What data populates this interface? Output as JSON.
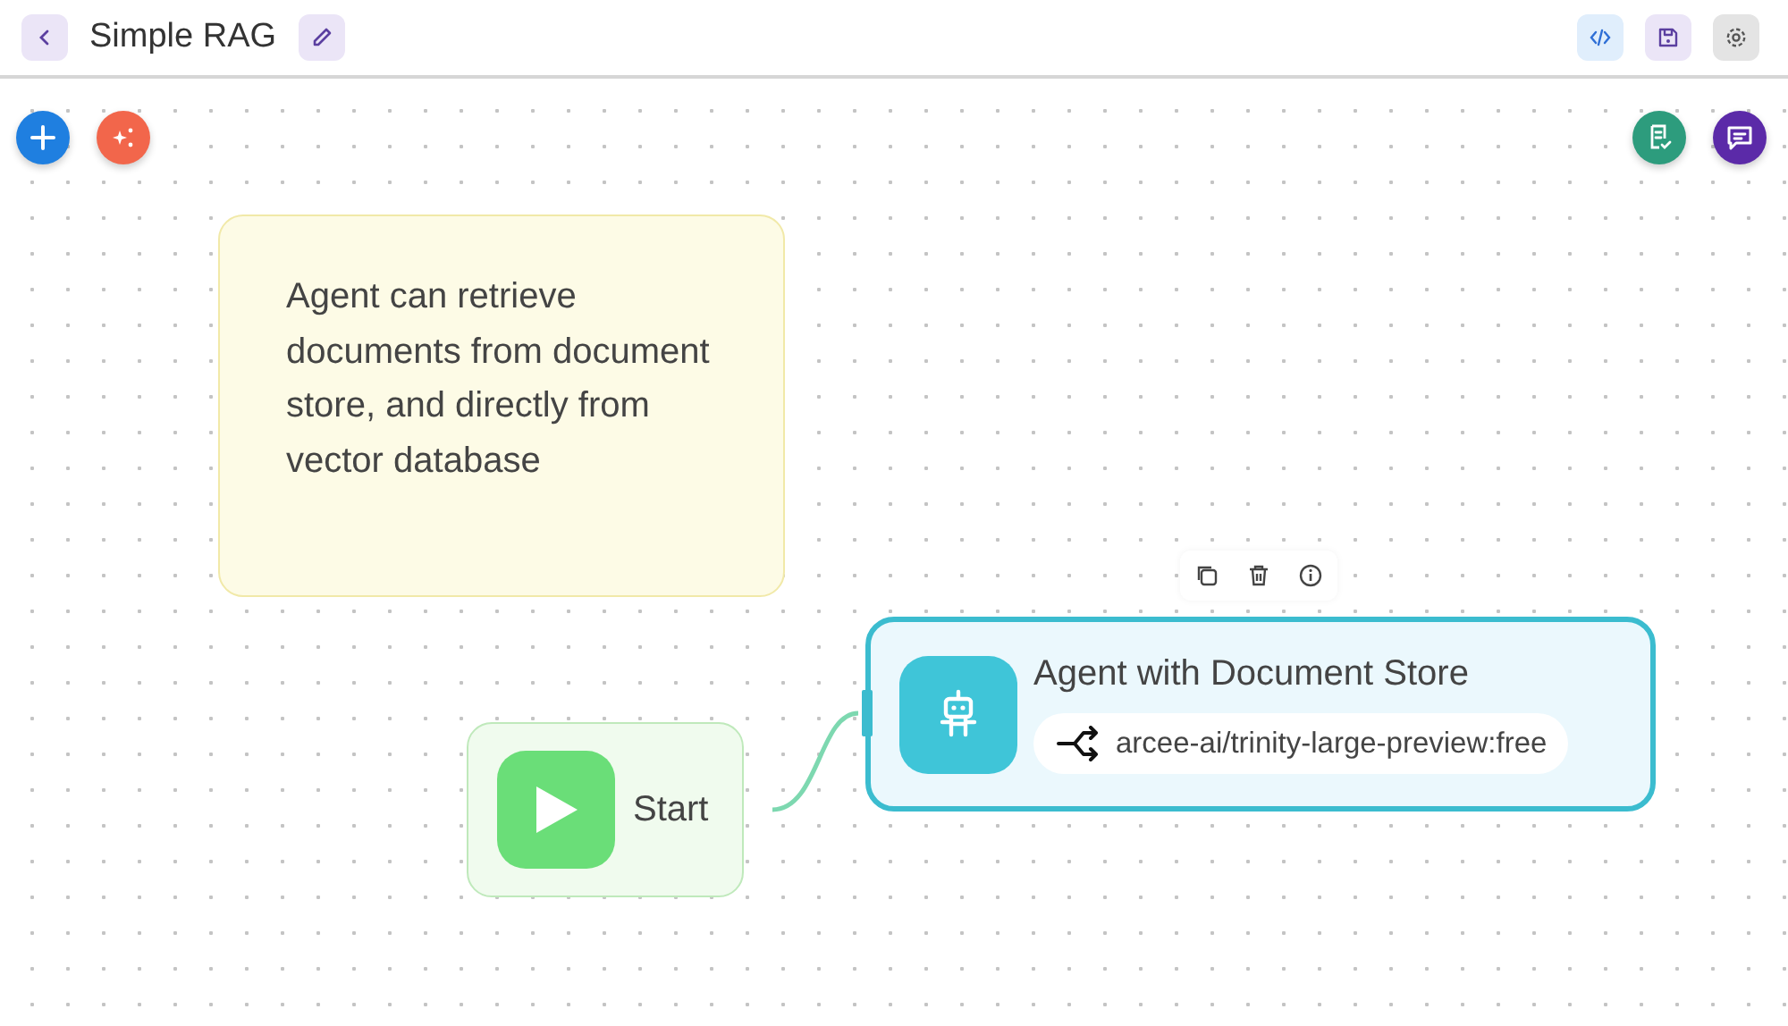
{
  "header": {
    "title": "Simple RAG"
  },
  "nodes": [
    {
      "kind": "note",
      "text": "Agent can retrieve documents from document store, and directly from vector database",
      "selected": false
    },
    {
      "kind": "start",
      "label": "Start",
      "selected": false
    },
    {
      "kind": "agent",
      "label": "Agent with Document Store",
      "model": "arcee-ai/trinity-large-preview:free",
      "selected": true
    }
  ]
}
